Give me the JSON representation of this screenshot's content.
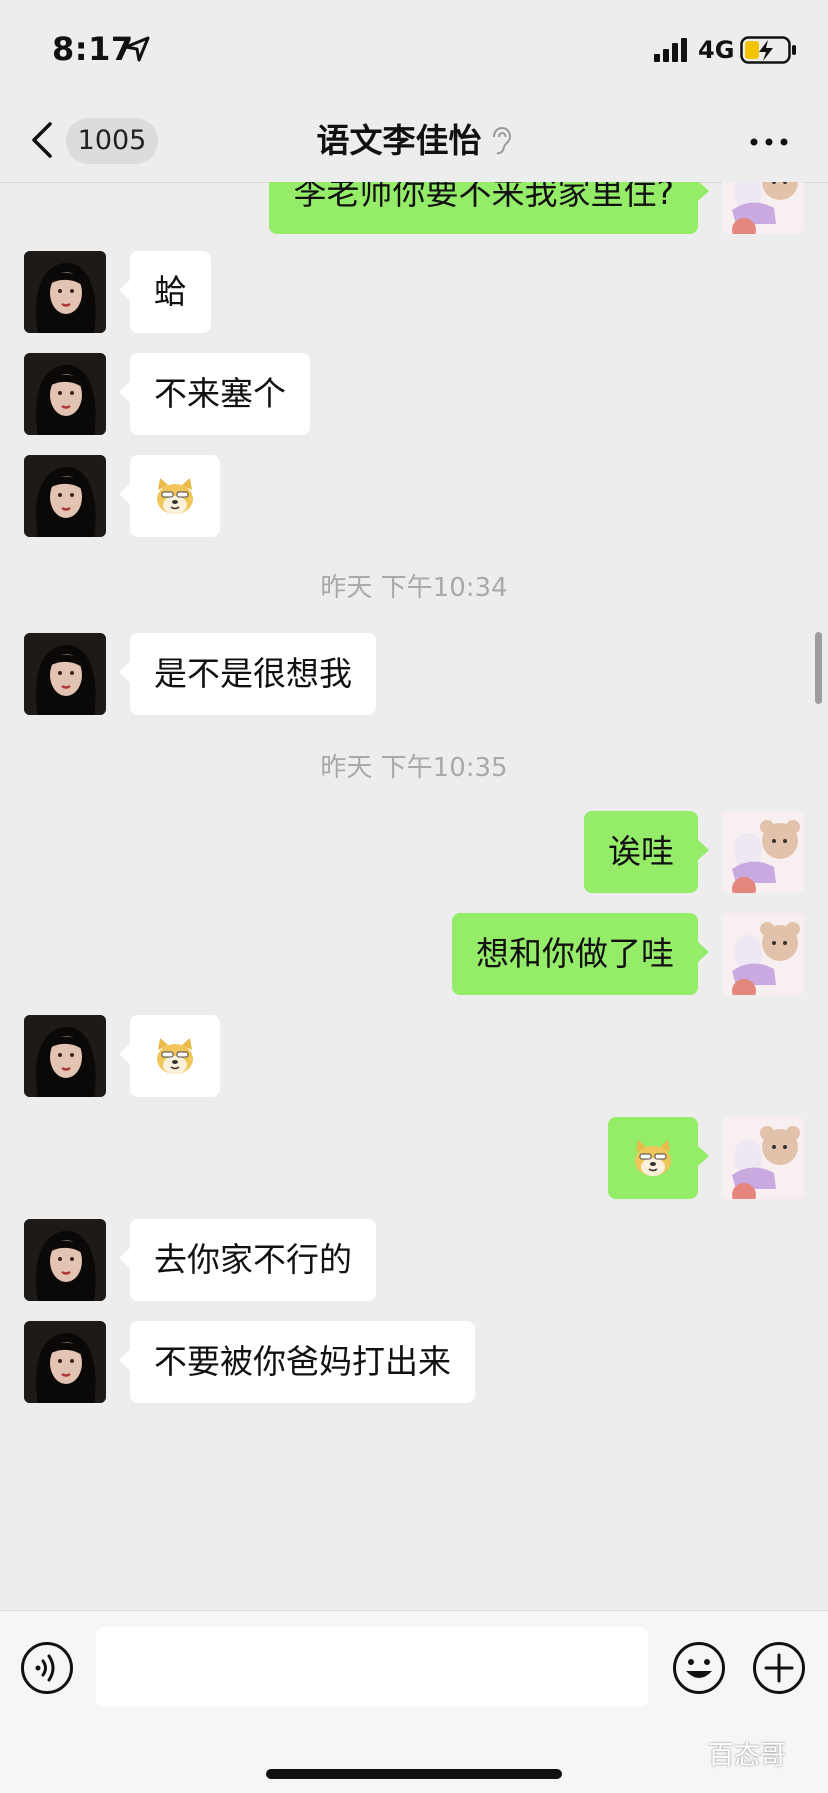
{
  "status_bar": {
    "time": "8:17",
    "network": "4G"
  },
  "nav": {
    "back_count": "1005",
    "title": "语文李佳怡"
  },
  "messages": [
    {
      "side": "out",
      "type": "text",
      "text": "李老师你要不来我家里住?"
    },
    {
      "side": "in",
      "type": "text",
      "text": "蛤"
    },
    {
      "side": "in",
      "type": "text",
      "text": "不来塞个"
    },
    {
      "side": "in",
      "type": "sticker",
      "icon": "doge-emoji-icon"
    },
    {
      "type": "timestamp",
      "text": "昨天 下午10:34"
    },
    {
      "side": "in",
      "type": "text",
      "text": "是不是很想我"
    },
    {
      "type": "timestamp",
      "text": "昨天 下午10:35"
    },
    {
      "side": "out",
      "type": "text",
      "text": "诶哇"
    },
    {
      "side": "out",
      "type": "text",
      "text": "想和你做了哇"
    },
    {
      "side": "in",
      "type": "sticker",
      "icon": "doge-emoji-icon"
    },
    {
      "side": "out",
      "type": "sticker",
      "icon": "doge-emoji-icon"
    },
    {
      "side": "in",
      "type": "text",
      "text": "去你家不行的"
    },
    {
      "side": "in",
      "type": "text",
      "text": "不要被你爸妈打出来"
    }
  ],
  "input": {
    "value": "",
    "placeholder": ""
  },
  "watermark": "百态哥",
  "colors": {
    "outgoing_bubble": "#95ec69",
    "incoming_bubble": "#ffffff",
    "background": "#ededed"
  }
}
